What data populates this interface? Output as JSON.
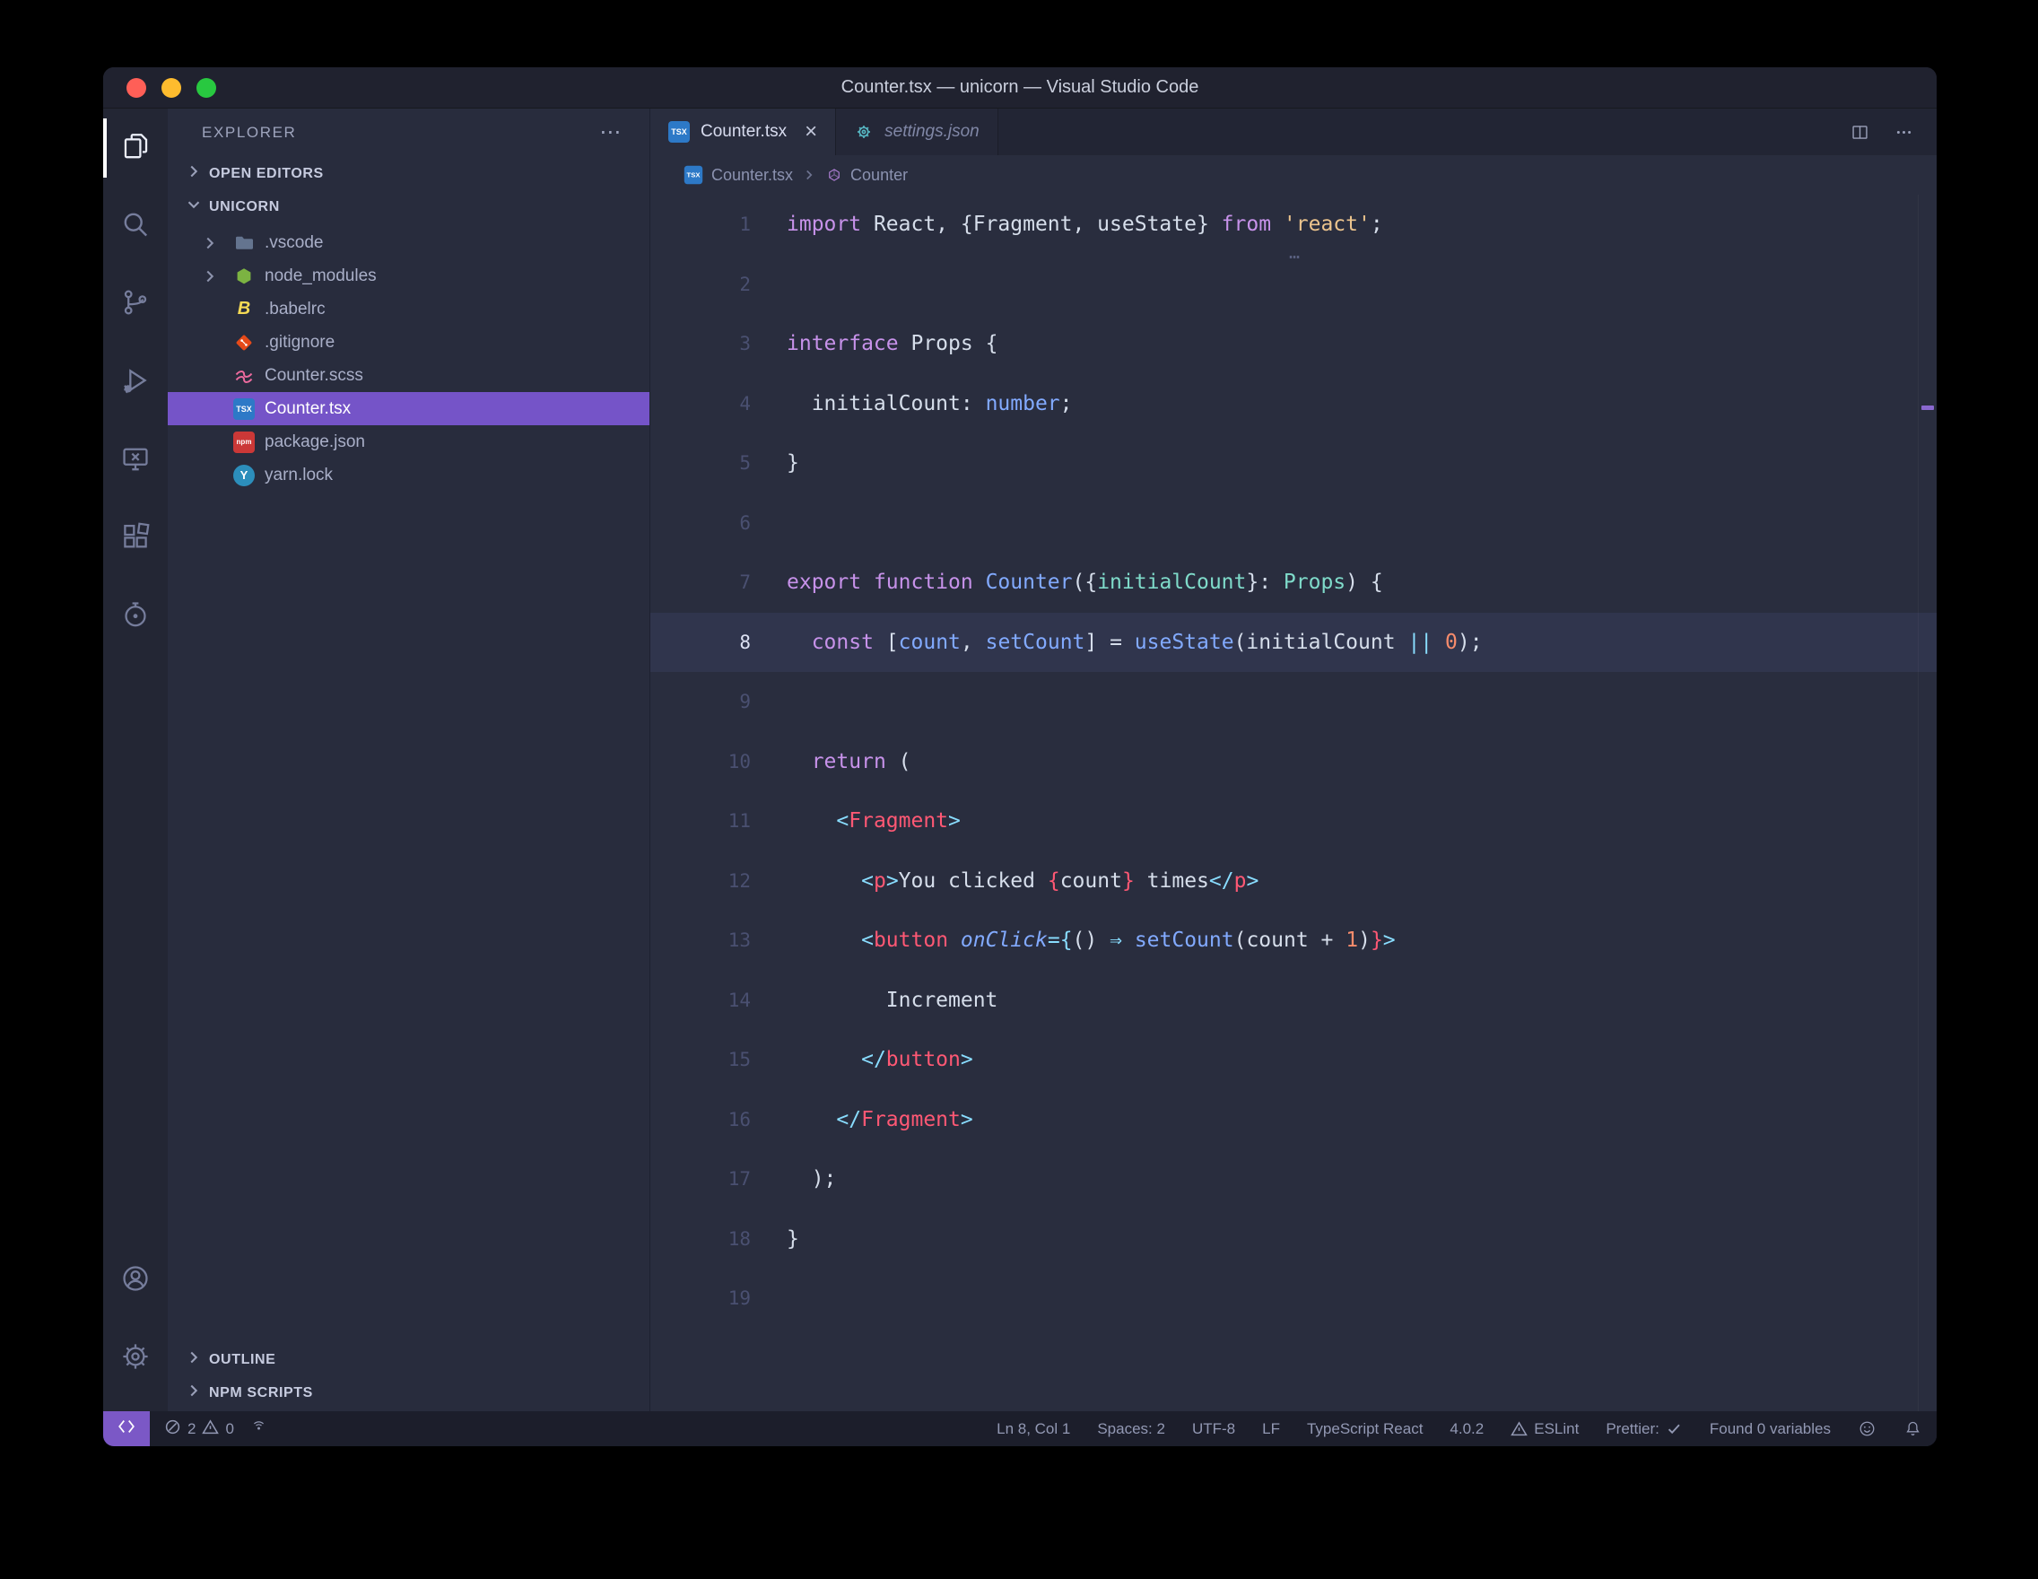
{
  "window": {
    "title": "Counter.tsx — unicorn — Visual Studio Code"
  },
  "sidebar": {
    "title": "EXPLORER",
    "actions_more": "⋯",
    "open_editors_label": "OPEN EDITORS",
    "project_label": "UNICORN",
    "outline_label": "OUTLINE",
    "npm_scripts_label": "NPM SCRIPTS",
    "files": [
      {
        "label": ".vscode",
        "icon": "folder",
        "chevron": true
      },
      {
        "label": "node_modules",
        "icon": "node",
        "chevron": true
      },
      {
        "label": ".babelrc",
        "icon": "babel"
      },
      {
        "label": ".gitignore",
        "icon": "git"
      },
      {
        "label": "Counter.scss",
        "icon": "sass"
      },
      {
        "label": "Counter.tsx",
        "icon": "tsx",
        "selected": true
      },
      {
        "label": "package.json",
        "icon": "npm"
      },
      {
        "label": "yarn.lock",
        "icon": "yarn"
      }
    ]
  },
  "tabs": [
    {
      "label": "Counter.tsx",
      "icon": "tsx",
      "active": true,
      "close": "×"
    },
    {
      "label": "settings.json",
      "icon": "gear-json",
      "italic": true
    }
  ],
  "breadcrumb": {
    "items": [
      {
        "icon": "tsx",
        "label": "Counter.tsx"
      },
      {
        "icon": "symbol",
        "label": "Counter"
      }
    ]
  },
  "editor": {
    "active_line": 8,
    "hint": "…",
    "lines": [
      {
        "num": 1,
        "tokens": [
          {
            "c": "k",
            "t": "import "
          },
          {
            "c": "d",
            "t": "React, {Fragment, useState} "
          },
          {
            "c": "k",
            "t": "from "
          },
          {
            "c": "s",
            "t": "'react'"
          },
          {
            "c": "d",
            "t": ";"
          }
        ]
      },
      {
        "num": 2,
        "tokens": []
      },
      {
        "num": 3,
        "tokens": [
          {
            "c": "k",
            "t": "interface "
          },
          {
            "c": "d",
            "t": "Props {"
          }
        ]
      },
      {
        "num": 4,
        "tokens": [
          {
            "c": "d",
            "t": "  initialCount: "
          },
          {
            "c": "f",
            "t": "number"
          },
          {
            "c": "d",
            "t": ";"
          }
        ]
      },
      {
        "num": 5,
        "tokens": [
          {
            "c": "d",
            "t": "}"
          }
        ]
      },
      {
        "num": 6,
        "tokens": []
      },
      {
        "num": 7,
        "tokens": [
          {
            "c": "k",
            "t": "export "
          },
          {
            "c": "k",
            "t": "function "
          },
          {
            "c": "f",
            "t": "Counter"
          },
          {
            "c": "d",
            "t": "({"
          },
          {
            "c": "t",
            "t": "initialCount"
          },
          {
            "c": "d",
            "t": "}: "
          },
          {
            "c": "t",
            "t": "Props"
          },
          {
            "c": "d",
            "t": ") {"
          }
        ]
      },
      {
        "num": 8,
        "tokens": [
          {
            "c": "d",
            "t": "  "
          },
          {
            "c": "k",
            "t": "const "
          },
          {
            "c": "d",
            "t": "["
          },
          {
            "c": "f",
            "t": "count"
          },
          {
            "c": "d",
            "t": ", "
          },
          {
            "c": "f",
            "t": "setCount"
          },
          {
            "c": "d",
            "t": "] = "
          },
          {
            "c": "f",
            "t": "useState"
          },
          {
            "c": "d",
            "t": "(initialCount "
          },
          {
            "c": "c",
            "t": "||"
          },
          {
            "c": "d",
            "t": " "
          },
          {
            "c": "n",
            "t": "0"
          },
          {
            "c": "d",
            "t": ");"
          }
        ]
      },
      {
        "num": 9,
        "tokens": []
      },
      {
        "num": 10,
        "tokens": [
          {
            "c": "d",
            "t": "  "
          },
          {
            "c": "k",
            "t": "return"
          },
          {
            "c": "d",
            "t": " ("
          }
        ]
      },
      {
        "num": 11,
        "tokens": [
          {
            "c": "d",
            "t": "    "
          },
          {
            "c": "c",
            "t": "<"
          },
          {
            "c": "p",
            "t": "Fragment"
          },
          {
            "c": "c",
            "t": ">"
          }
        ]
      },
      {
        "num": 12,
        "tokens": [
          {
            "c": "d",
            "t": "      "
          },
          {
            "c": "c",
            "t": "<"
          },
          {
            "c": "p",
            "t": "p"
          },
          {
            "c": "c",
            "t": ">"
          },
          {
            "c": "d",
            "t": "You clicked "
          },
          {
            "c": "p",
            "t": "{"
          },
          {
            "c": "d",
            "t": "count"
          },
          {
            "c": "p",
            "t": "}"
          },
          {
            "c": "d",
            "t": " times"
          },
          {
            "c": "c",
            "t": "</"
          },
          {
            "c": "p",
            "t": "p"
          },
          {
            "c": "c",
            "t": ">"
          }
        ]
      },
      {
        "num": 13,
        "tokens": [
          {
            "c": "d",
            "t": "      "
          },
          {
            "c": "c",
            "t": "<"
          },
          {
            "c": "p",
            "t": "button"
          },
          {
            "c": "d",
            "t": " "
          },
          {
            "c": "i",
            "t": "onClick"
          },
          {
            "c": "c",
            "t": "={"
          },
          {
            "c": "d",
            "t": "() "
          },
          {
            "c": "c",
            "t": "⇒"
          },
          {
            "c": "d",
            "t": " "
          },
          {
            "c": "f",
            "t": "setCount"
          },
          {
            "c": "d",
            "t": "(count + "
          },
          {
            "c": "n",
            "t": "1"
          },
          {
            "c": "d",
            "t": ")"
          },
          {
            "c": "p",
            "t": "}"
          },
          {
            "c": "c",
            "t": ">"
          }
        ]
      },
      {
        "num": 14,
        "tokens": [
          {
            "c": "d",
            "t": "        Increment"
          }
        ]
      },
      {
        "num": 15,
        "tokens": [
          {
            "c": "d",
            "t": "      "
          },
          {
            "c": "c",
            "t": "</"
          },
          {
            "c": "p",
            "t": "button"
          },
          {
            "c": "c",
            "t": ">"
          }
        ]
      },
      {
        "num": 16,
        "tokens": [
          {
            "c": "d",
            "t": "    "
          },
          {
            "c": "c",
            "t": "</"
          },
          {
            "c": "p",
            "t": "Fragment"
          },
          {
            "c": "c",
            "t": ">"
          }
        ]
      },
      {
        "num": 17,
        "tokens": [
          {
            "c": "d",
            "t": "  );"
          }
        ]
      },
      {
        "num": 18,
        "tokens": [
          {
            "c": "d",
            "t": "}"
          }
        ]
      },
      {
        "num": 19,
        "tokens": []
      }
    ]
  },
  "status_bar": {
    "errors": "2",
    "warnings": "0",
    "items_right": [
      {
        "label": "Ln 8, Col 1"
      },
      {
        "label": "Spaces: 2"
      },
      {
        "label": "UTF-8"
      },
      {
        "label": "LF"
      },
      {
        "label": "TypeScript React"
      },
      {
        "label": "4.0.2"
      },
      {
        "label": "ESLint",
        "icon": "warning"
      },
      {
        "label": "Prettier:",
        "icon_after": "check"
      },
      {
        "label": "Found 0 variables"
      }
    ]
  }
}
